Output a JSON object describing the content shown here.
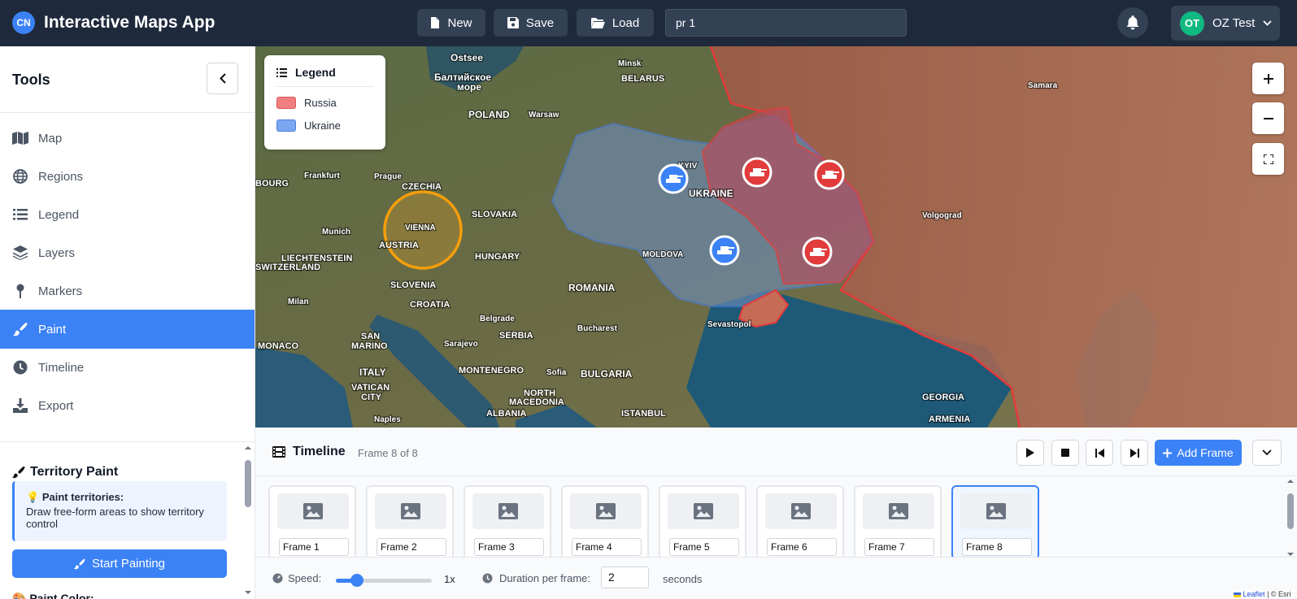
{
  "header": {
    "logo": "CN",
    "app_title": "Interactive Maps App",
    "new_label": "New",
    "save_label": "Save",
    "load_label": "Load",
    "project_name": "pr 1",
    "user_initials": "OT",
    "user_name": "OZ Test"
  },
  "sidebar": {
    "title": "Tools",
    "items": [
      {
        "label": "Map",
        "icon": "map-icon"
      },
      {
        "label": "Regions",
        "icon": "globe-icon"
      },
      {
        "label": "Legend",
        "icon": "list-icon"
      },
      {
        "label": "Layers",
        "icon": "layers-icon"
      },
      {
        "label": "Markers",
        "icon": "pin-icon"
      },
      {
        "label": "Paint",
        "icon": "brush-icon",
        "active": true
      },
      {
        "label": "Timeline",
        "icon": "clock-icon"
      },
      {
        "label": "Export",
        "icon": "download-icon"
      }
    ],
    "panel": {
      "title": "Territory Paint",
      "info_title": "Paint territories:",
      "info_text": "Draw free-form areas to show territory control",
      "start_button": "Start Painting",
      "paint_color_label": "Paint Color:"
    }
  },
  "map": {
    "legend": {
      "title": "Legend",
      "items": [
        {
          "label": "Russia",
          "color": "#f08080"
        },
        {
          "label": "Ukraine",
          "color": "#7aa7f0"
        }
      ]
    },
    "labels": {
      "ostsee": "Ostsee",
      "baltic1": "Балтийское",
      "baltic2": "море",
      "minsk": "Minsk",
      "belarus": "BELARUS",
      "poland": "POLAND",
      "warsaw": "Warsaw",
      "samara": "Samara",
      "kyiv": "KYIV",
      "ukraine": "UKRAINE",
      "czechia": "CZECHIA",
      "prague": "Prague",
      "frankfurt": "Frankfurt",
      "luxembourg": "BOURG",
      "slovakia": "SLOVAKIA",
      "vienna": "VIENNA",
      "austria": "AUSTRIA",
      "munich": "Munich",
      "hungary": "HUNGARY",
      "moldova": "MOLDOVA",
      "volgograd": "Volgograd",
      "liechtenstein": "LIECHTENSTEIN",
      "switzerland": "SWITZERLAND",
      "slovenia": "SLOVENIA",
      "croatia": "CROATIA",
      "romania": "ROMANIA",
      "milan": "Milan",
      "belgrade": "Belgrade",
      "serbia": "SERBIA",
      "bucharest": "Bucharest",
      "sevastopol": "Sevastopol",
      "monaco": "MONACO",
      "sanmarino1": "SAN",
      "sanmarino2": "MARINO",
      "sarajevo": "Sarajevo",
      "italy": "ITALY",
      "vatican1": "VATICAN",
      "vatican2": "CITY",
      "montenegro": "MONTENEGRO",
      "sofia": "Sofia",
      "bulgaria": "BULGARIA",
      "northmacedonia1": "NORTH",
      "northmacedonia2": "MACEDONIA",
      "albania": "ALBANIA",
      "istanbul": "ISTANBUL",
      "naples": "Naples",
      "georgia": "GEORGIA",
      "armenia": "ARMENIA"
    },
    "attribution_link": "Leaflet",
    "attribution_rest": "| © Esri"
  },
  "timeline": {
    "title": "Timeline",
    "frame_status": "Frame 8 of 8",
    "add_frame_label": "Add Frame",
    "frames": [
      "Frame 1",
      "Frame 2",
      "Frame 3",
      "Frame 4",
      "Frame 5",
      "Frame 6",
      "Frame 7",
      "Frame 8"
    ],
    "selected_frame": 8,
    "speed_label": "Speed:",
    "speed_value": "1x",
    "speed_fraction": 0.22,
    "duration_label": "Duration per frame:",
    "duration_value": "2",
    "duration_unit": "seconds"
  }
}
